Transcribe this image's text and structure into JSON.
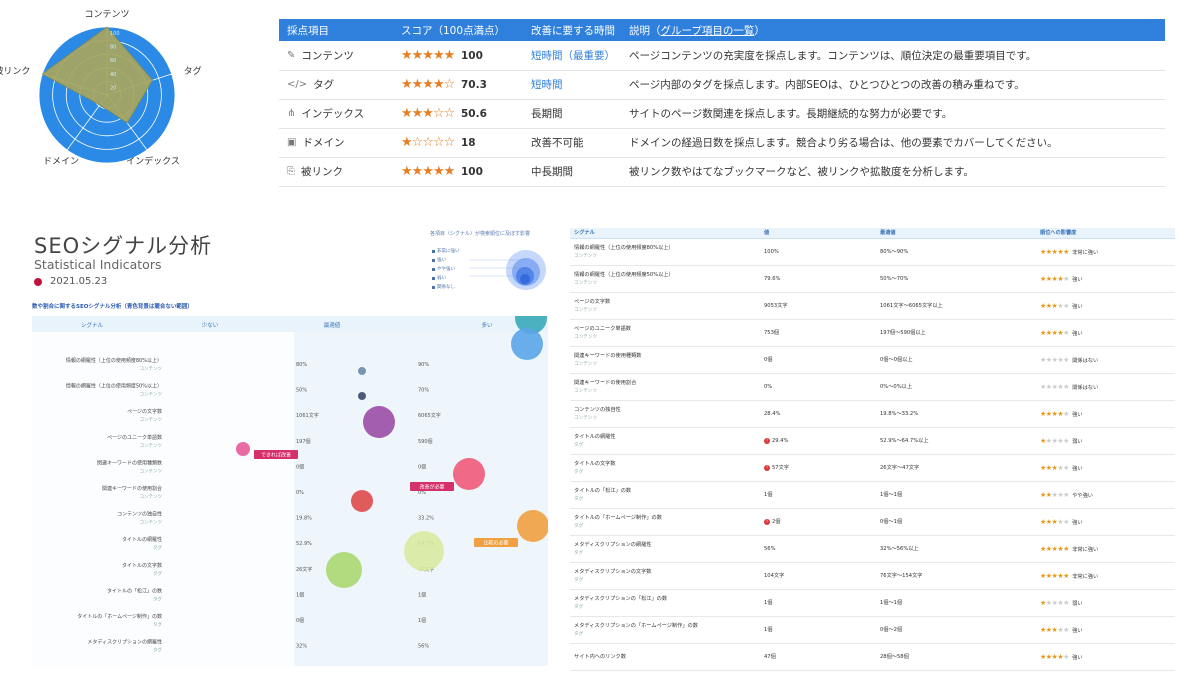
{
  "radar": {
    "labels": [
      "コンテンツ",
      "タグ",
      "インデックス",
      "ドメイン",
      "被リンク"
    ],
    "scores": [
      100,
      70.3,
      50.6,
      18,
      100
    ],
    "ticks": [
      "100",
      "80",
      "60",
      "40",
      "20"
    ],
    "colors": {
      "background": "#2a8ae6",
      "fill": "#a7a65f",
      "grid": "#ffffff"
    }
  },
  "score_table": {
    "headers": [
      "採点項目",
      "スコア（100点満点）",
      "改善に要する時間",
      "説明（",
      "グループ項目の一覧",
      "）"
    ],
    "rows": [
      {
        "icon": "edit-icon",
        "glyph": "✎",
        "item": "コンテンツ",
        "stars": "★★★★★",
        "score": "100",
        "time": "短時間（最重要）",
        "time_link": true,
        "desc": "ページコンテンツの充実度を採点します。コンテンツは、順位決定の最重要項目です。"
      },
      {
        "icon": "code-icon",
        "glyph": "</>",
        "item": "タグ",
        "stars": "★★★★☆",
        "score": "70.3",
        "time": "短時間",
        "time_link": true,
        "desc": "ページ内部のタグを採点します。内部SEOは、ひとつひとつの改善の積み重ねです。"
      },
      {
        "icon": "sitemap-icon",
        "glyph": "⋔",
        "item": "インデックス",
        "stars": "★★★☆☆",
        "score": "50.6",
        "time": "長期間",
        "time_link": false,
        "desc": "サイトのページ数関連を採点します。長期継続的な努力が必要です。"
      },
      {
        "icon": "domain-icon",
        "glyph": "▣",
        "item": "ドメイン",
        "stars": "★☆☆☆☆",
        "score": "18",
        "time": "改善不可能",
        "time_link": false,
        "desc": "ドメインの経過日数を採点します。競合より劣る場合は、他の要素でカバーしてください。"
      },
      {
        "icon": "backlink-icon",
        "glyph": "⎘",
        "item": "被リンク",
        "stars": "★★★★★",
        "score": "100",
        "time": "中長期間",
        "time_link": false,
        "desc": "被リンク数やはてなブックマークなど、被リンクや拡散度を分析します。"
      }
    ],
    "colors": {
      "header": "#2f7fdc",
      "stars": "#e67e22"
    }
  },
  "seo_panel": {
    "title": "SEOシグナル分析",
    "subtitle": "Statistical Indicators",
    "date": "2021.05.23",
    "legend_title": "各項目（シグナル）が検索順位に及ぼす影響",
    "legend_items": [
      "非常に強い",
      "強い",
      "やや強い",
      "弱い",
      "関係なし"
    ],
    "chart_caption": "数や割合に関するSEOシグナル分析（青色背景は競合ない範囲）",
    "col_headers": [
      "シグナル",
      "少ない",
      "最適値",
      "多い"
    ],
    "rows": [
      {
        "label": "情報の網羅性（上位の使用頻度80%以上）",
        "cat": "コンテンツ",
        "low": "80%",
        "high": "90%"
      },
      {
        "label": "情報の網羅性（上位の使用頻度50%以上）",
        "cat": "コンテンツ",
        "low": "50%",
        "high": "70%"
      },
      {
        "label": "ページの文字数",
        "cat": "コンテンツ",
        "low": "1061文字",
        "high": "6065文字"
      },
      {
        "label": "ページのユニーク単語数",
        "cat": "コンテンツ",
        "low": "197個",
        "high": "590個"
      },
      {
        "label": "関連キーワードの使用種類数",
        "cat": "コンテンツ",
        "low": "0個",
        "high": "0個"
      },
      {
        "label": "関連キーワードの使用割合",
        "cat": "コンテンツ",
        "low": "0%",
        "high": "0%"
      },
      {
        "label": "コンテンツの独自性",
        "cat": "コンテンツ",
        "low": "19.8%",
        "high": "33.2%"
      },
      {
        "label": "タイトルの網羅性",
        "cat": "タグ",
        "low": "52.9%",
        "high": "64.7%"
      },
      {
        "label": "タイトルの文字数",
        "cat": "タグ",
        "low": "26文字",
        "high": "47文字"
      },
      {
        "label": "タイトルの「松江」の数",
        "cat": "タグ",
        "low": "1個",
        "high": "1個"
      },
      {
        "label": "タイトルの「ホームページ制作」の数",
        "cat": "タグ",
        "low": "0個",
        "high": "1個"
      },
      {
        "label": "メタディスクリプションの網羅性",
        "cat": "タグ",
        "low": "32%",
        "high": "56%"
      }
    ],
    "tags": [
      "できれば改善",
      "改善が必要",
      "比較の必要"
    ]
  },
  "signal_table": {
    "headers": [
      "シグナル",
      "値",
      "最適値",
      "順位への影響度"
    ],
    "rows": [
      {
        "signal": "情報の網羅性（上位の使用頻度80%以上）",
        "cat": "コンテンツ",
        "value": "100%",
        "warn": false,
        "optimal": "80%〜90%",
        "stars": 5,
        "impact": "非常に強い"
      },
      {
        "signal": "情報の網羅性（上位の使用頻度50%以上）",
        "cat": "コンテンツ",
        "value": "79.6%",
        "warn": false,
        "optimal": "50%〜70%",
        "stars": 4,
        "impact": "強い"
      },
      {
        "signal": "ページの文字数",
        "cat": "コンテンツ",
        "value": "9053文字",
        "warn": false,
        "optimal": "1061文字〜6065文字以上",
        "stars": 3,
        "impact": "強い"
      },
      {
        "signal": "ページのユニーク単語数",
        "cat": "コンテンツ",
        "value": "753個",
        "warn": false,
        "optimal": "197個〜590個以上",
        "stars": 4,
        "impact": "強い"
      },
      {
        "signal": "関連キーワードの使用種類数",
        "cat": "コンテンツ",
        "value": "0個",
        "warn": false,
        "optimal": "0個〜0個以上",
        "stars": 0,
        "impact": "関係はない"
      },
      {
        "signal": "関連キーワードの使用割合",
        "cat": "コンテンツ",
        "value": "0%",
        "warn": false,
        "optimal": "0%〜0%以上",
        "stars": 0,
        "impact": "関係はない"
      },
      {
        "signal": "コンテンツの独自性",
        "cat": "コンテンツ",
        "value": "28.4%",
        "warn": false,
        "optimal": "19.8%〜33.2%",
        "stars": 4,
        "impact": "強い"
      },
      {
        "signal": "タイトルの網羅性",
        "cat": "タグ",
        "value": "29.4%",
        "warn": true,
        "optimal": "52.9%〜64.7%以上",
        "stars": 1,
        "impact": "弱い"
      },
      {
        "signal": "タイトルの文字数",
        "cat": "タグ",
        "value": "57文字",
        "warn": true,
        "optimal": "26文字〜47文字",
        "stars": 3,
        "impact": "強い"
      },
      {
        "signal": "タイトルの「松江」の数",
        "cat": "タグ",
        "value": "1個",
        "warn": false,
        "optimal": "1個〜1個",
        "stars": 2,
        "impact": "やや強い"
      },
      {
        "signal": "タイトルの「ホームページ制作」の数",
        "cat": "タグ",
        "value": "2個",
        "warn": true,
        "optimal": "0個〜1個",
        "stars": 3,
        "impact": "強い"
      },
      {
        "signal": "メタディスクリプションの網羅性",
        "cat": "タグ",
        "value": "56%",
        "warn": false,
        "optimal": "32%〜56%以上",
        "stars": 5,
        "impact": "非常に強い"
      },
      {
        "signal": "メタディスクリプションの文字数",
        "cat": "タグ",
        "value": "104文字",
        "warn": false,
        "optimal": "76文字〜154文字",
        "stars": 5,
        "impact": "非常に強い"
      },
      {
        "signal": "メタディスクリプションの「松江」の数",
        "cat": "タグ",
        "value": "1個",
        "warn": false,
        "optimal": "1個〜1個",
        "stars": 1,
        "impact": "弱い"
      },
      {
        "signal": "メタディスクリプションの「ホームページ制作」の数",
        "cat": "タグ",
        "value": "1個",
        "warn": false,
        "optimal": "0個〜2個",
        "stars": 3,
        "impact": "強い"
      },
      {
        "signal": "サイト内へのリンク数",
        "cat": "",
        "value": "47個",
        "warn": false,
        "optimal": "28個〜58個",
        "stars": 4,
        "impact": "強い"
      }
    ]
  }
}
